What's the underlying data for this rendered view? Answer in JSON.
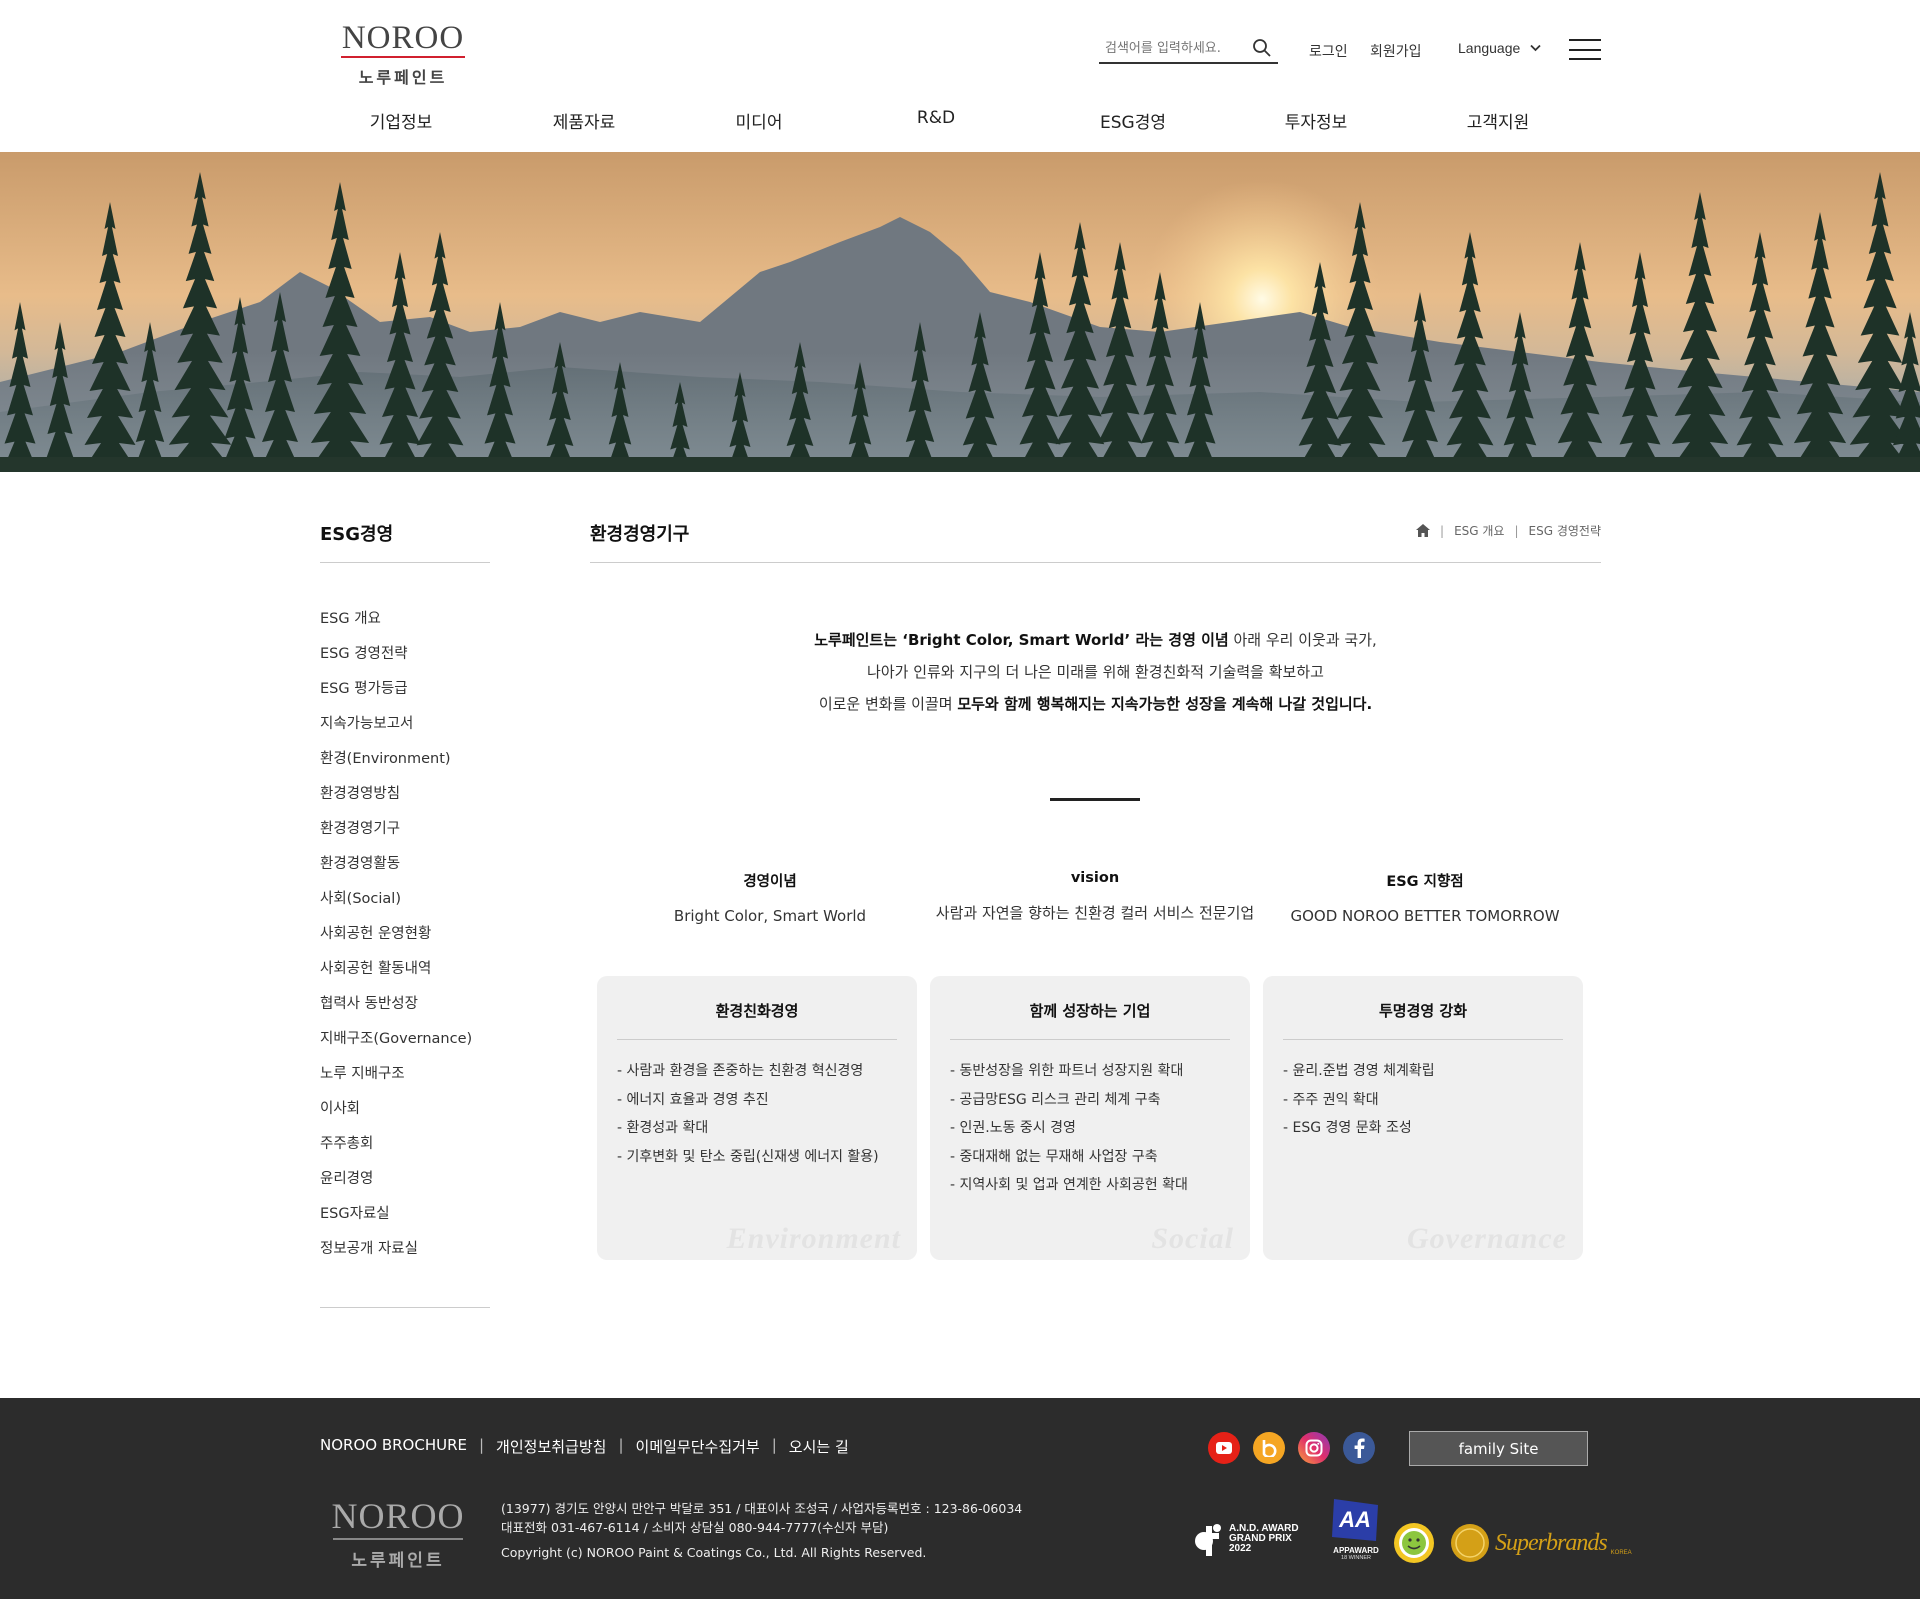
{
  "header": {
    "logo_en": "NOROO",
    "logo_ko": "노루페인트",
    "search_placeholder": "검색어를 입력하세요.",
    "login": "로그인",
    "signup": "회원가입",
    "language": "Language"
  },
  "gnb": [
    "기업정보",
    "제품자료",
    "미디어",
    "R&D",
    "ESG경영",
    "투자정보",
    "고객지원"
  ],
  "sidebar": {
    "title": "ESG경영",
    "items": [
      "ESG 개요",
      "ESG 경영전략",
      "ESG 평가등급",
      "지속가능보고서",
      "환경(Environment)",
      "환경경영방침",
      "환경경영기구",
      "환경경영활동",
      "사회(Social)",
      "사회공헌 운영현황",
      "사회공헌 활동내역",
      "협력사 동반성장",
      "지배구조(Governance)",
      "노루 지배구조",
      "이사회",
      "주주총회",
      "윤리경영",
      "ESG자료실",
      "정보공개 자료실"
    ]
  },
  "content": {
    "title": "환경경영기구",
    "breadcrumb": [
      "ESG 개요",
      "ESG 경영전략"
    ],
    "intro": {
      "l1_bold": "노루페인트는 ‘Bright Color, Smart World’ 라는 경영 이념",
      "l1_rest": " 아래 우리 이웃과 국가,",
      "l2": "나아가 인류와 지구의 더 나은 미래를 위해 환경친화적 기술력을 확보하고",
      "l3_pre": "이로운 변화를 이끌며 ",
      "l3_bold": "모두와 함께 행복해지는 지속가능한 성장을 계속해 나갈 것입니다."
    },
    "pillars": [
      {
        "title": "경영이념",
        "desc": "Bright Color, Smart World"
      },
      {
        "title": "vision",
        "desc": "사람과 자연을 향하는 친환경 컬러 서비스 전문기업"
      },
      {
        "title": "ESG 지향점",
        "desc": "GOOD NOROO BETTER TOMORROW"
      }
    ],
    "cards": [
      {
        "title": "환경친화경영",
        "items": [
          "- 사람과 환경을 존중하는 친환경 혁신경영",
          "- 에너지 효율과 경영 추진",
          "- 환경성과 확대",
          "- 기후변화 및 탄소 중립(신재생 에너지 활용)"
        ],
        "watermark": "Environment"
      },
      {
        "title": "함께 성장하는 기업",
        "items": [
          "- 동반성장을 위한 파트너 성장지원 확대",
          "- 공급망ESG 리스크 관리 체계 구축",
          "- 인권.노동 중시 경영",
          "- 중대재해 없는 무재해 사업장 구축",
          "- 지역사회 및 업과 연계한 사회공헌 확대"
        ],
        "watermark": "Social"
      },
      {
        "title": "투명경영 강화",
        "items": [
          "- 윤리.준법 경영 체계확립",
          "- 주주 권익 확대",
          "- ESG 경영 문화 조성"
        ],
        "watermark": "Governance"
      }
    ]
  },
  "footer": {
    "links": [
      "NOROO BROCHURE",
      "개인정보취급방침",
      "이메일무단수집거부",
      "오시는 길"
    ],
    "family_site": "family Site",
    "logo_en": "NOROO",
    "logo_ko": "노루페인트",
    "address": "(13977) 경기도 안양시 만안구 박달로 351 / 대표이사 조성국 / 사업자등록번호 : 123-86-06034",
    "phone": "대표전화 031-467-6114 / 소비자 상담실 080-944-7777(수신자 부담)",
    "copyright": "Copyright (c) NOROO Paint & Coatings Co., Ltd. All Rights Reserved.",
    "awards": {
      "and_1": "A.N.D. AWARD",
      "and_2": "GRAND PRIX",
      "and_3": "2022",
      "app_1": "APPAWARD",
      "app_2": "18 WINNER",
      "superbrands": "Superbrands",
      "superbrands_sub": "KOREA"
    }
  },
  "colors": {
    "brand_red": "#d1202f",
    "footer_bg": "#2c2c2c",
    "card_bg": "#f0f0f0",
    "youtube": "#e62117",
    "blog": "#f5a623",
    "facebook": "#3b5998"
  },
  "icons": [
    "search-icon",
    "chevron-down-icon",
    "menu-icon",
    "home-icon",
    "youtube-icon",
    "blog-icon",
    "instagram-icon",
    "facebook-icon"
  ]
}
